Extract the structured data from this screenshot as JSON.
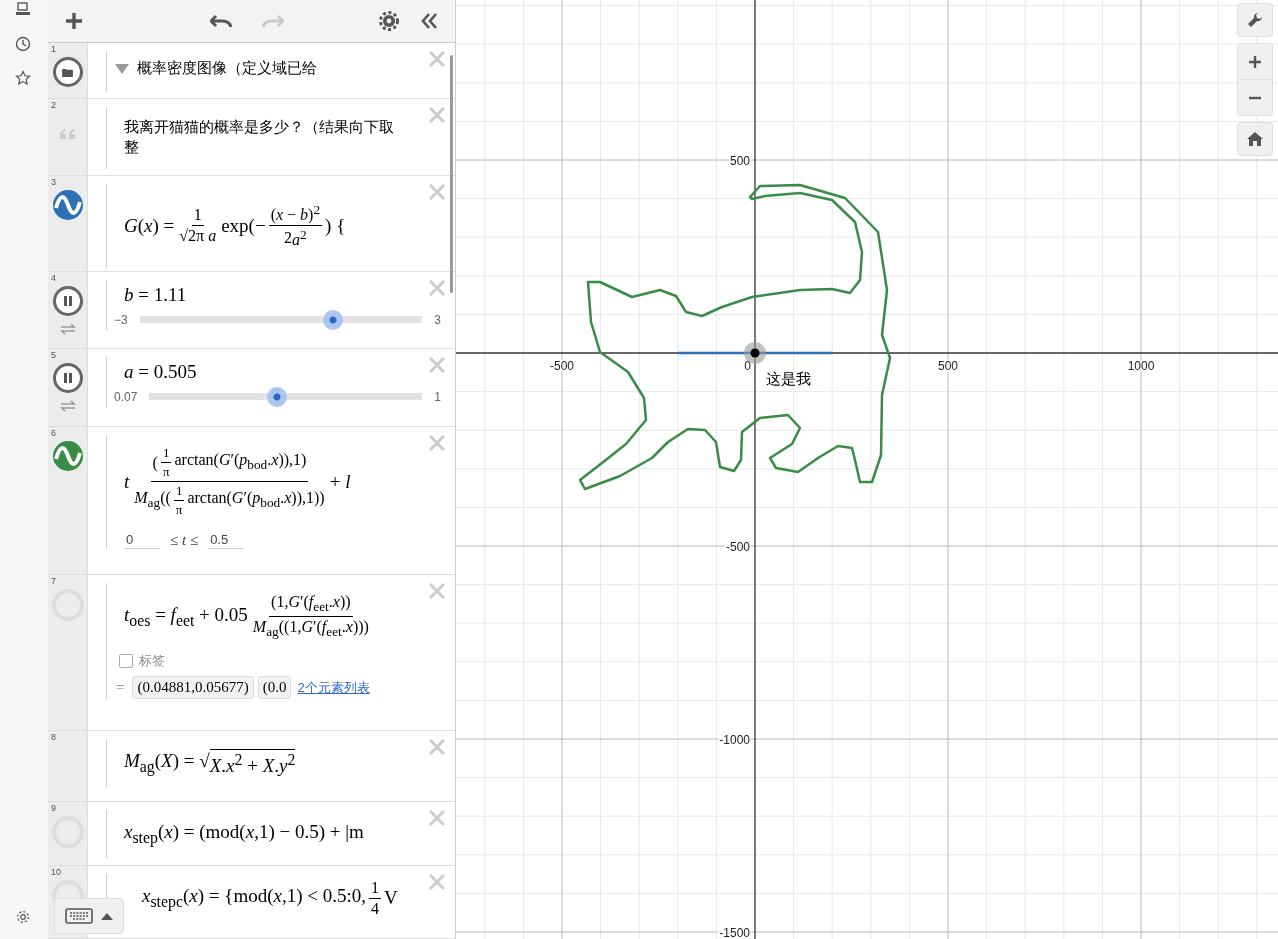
{
  "expressions": [
    {
      "number": "1",
      "kind": "folder",
      "title": "概率密度图像（定义域已给",
      "expanded": true
    },
    {
      "number": "2",
      "kind": "note",
      "text": "我离开猫猫的概率是多少？（结果向下取整"
    },
    {
      "number": "3",
      "kind": "math",
      "hidden": false,
      "color": "#2d70b3",
      "parts": [
        {
          "kind": "text",
          "text": "*G*(*x*) = "
        },
        {
          "kind": "fraction",
          "numerator": "1",
          "denominator": "√2π *a*"
        },
        {
          "kind": "text",
          "text": " exp(− "
        },
        {
          "kind": "fraction",
          "numerator": "(*x* − *b*)$^{2}$",
          "denominator": [
            {
              "kind": "text",
              "text": "2"
            },
            {
              "kind": "text",
              "text": "*a*$^{2}$"
            }
          ]
        },
        {
          "kind": "text",
          "text": ") {"
        }
      ]
    },
    {
      "number": "4",
      "kind": "slider",
      "parts": [
        {
          "kind": "text",
          "text": "*b* = 1.11"
        }
      ],
      "min": "−3",
      "max": "3",
      "level": 0.685
    },
    {
      "number": "5",
      "kind": "slider",
      "parts": [
        {
          "kind": "text",
          "text": "*a* = 0.505"
        }
      ],
      "min": "0.07",
      "max": "1",
      "level": 0.468
    },
    {
      "number": "6",
      "kind": "math",
      "hidden": false,
      "color": "#388c46",
      "parts": [
        {
          "kind": "text",
          "text": "*t*"
        },
        {
          "kind": "fraction",
          "numerator": [
            {
              "kind": "text",
              "text": "("
            },
            {
              "kind": "fraction",
              "numerator": "1",
              "denominator": "π"
            },
            {
              "kind": "text",
              "text": " arctan(*G*′(*p*$_{bod}$.*x*)),1)"
            }
          ],
          "denominator": [
            {
              "kind": "text",
              "text": "*M*$_{ag}$(("
            },
            {
              "kind": "fraction",
              "numerator": "1",
              "denominator": "π"
            },
            {
              "kind": "text",
              "text": " arctan(*G*′(*p*$_{bod}$.*x*)),1))"
            }
          ]
        },
        {
          "kind": "text",
          "text": " + *l*"
        }
      ],
      "domain": {
        "min": "0",
        "relation": "≤ *t* ≤",
        "max": "0.5"
      }
    },
    {
      "number": "7",
      "kind": "math",
      "hidden": true,
      "parts": [
        {
          "kind": "text",
          "text": "*t*$_{oes}$ = *f*$_{eet}$ + 0.05"
        },
        {
          "kind": "fraction",
          "numerator": "(1,*G*′(*f*$_{eet}$.*x*))",
          "denominator": "*M*$_{ag}$((1,*G*′(*f*$_{eet}$.*x*)))"
        }
      ],
      "label_option": {
        "label": "标签",
        "checked": false
      },
      "result": {
        "equals": "=",
        "values": [
          "(0.04881,0.05677)",
          "(0.0"
        ],
        "link": "2个元素列表"
      }
    },
    {
      "number": "8",
      "kind": "math",
      "hidden": false,
      "parts": [
        {
          "kind": "text",
          "text": "*M*$_{ag}$(*X*) = √"
        },
        {
          "kind": "overline",
          "text": "*X*.*x*$^{2}$ + *X*.*y*$^{2}$"
        }
      ]
    },
    {
      "number": "9",
      "kind": "math",
      "hidden": true,
      "parts": [
        {
          "kind": "text",
          "text": "*x*$_{step}$(*x*) = (mod(*x*,1) − 0.5) + |m"
        }
      ]
    },
    {
      "number": "10",
      "kind": "math",
      "hidden": true,
      "parts": [
        {
          "kind": "text",
          "text": "*x*$_{stepc}$(*x*) = {mod(*x*,1) < 0.5:0, "
        },
        {
          "kind": "fraction",
          "numerator": "1",
          "denominator": "4"
        },
        {
          "kind": "text",
          "text": " V"
        }
      ]
    }
  ],
  "graph": {
    "x_labels": [
      "-500",
      "0",
      "500",
      "1000"
    ],
    "y_labels": [
      "500",
      "-500",
      "-1000",
      "-1500"
    ],
    "point_label": "这是我"
  }
}
